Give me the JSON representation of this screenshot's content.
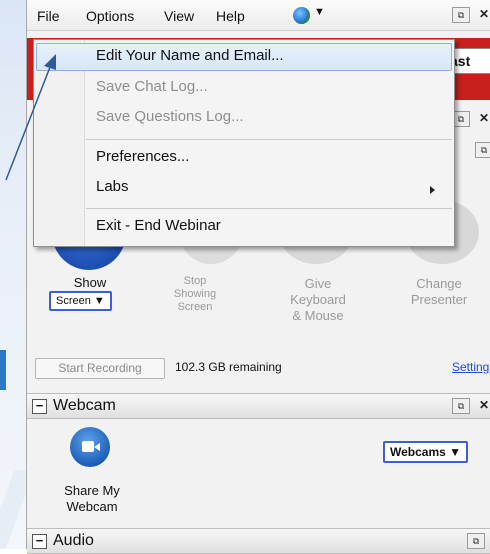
{
  "menubar": {
    "file": "File",
    "options": "Options",
    "view": "View",
    "help": "Help",
    "globe_icon": "globe-icon"
  },
  "options_menu": {
    "items": [
      {
        "label": "Edit Your Name and Email...",
        "enabled": true,
        "highlighted": true
      },
      {
        "label": "Save Chat Log...",
        "enabled": false
      },
      {
        "label": "Save Questions Log...",
        "enabled": false
      },
      {
        "label": "Preferences...",
        "enabled": true
      },
      {
        "label": "Labs",
        "enabled": true,
        "submenu": true
      },
      {
        "label": "Exit - End Webinar",
        "enabled": true
      }
    ]
  },
  "behind": {
    "broadcast_partial": "ast"
  },
  "screen_section": {
    "show": {
      "label": "Show",
      "dropdown": "Screen"
    },
    "stop_showing": {
      "line1": "Stop",
      "line2": "Showing",
      "line3": "Screen"
    },
    "give_control": {
      "line1": "Give",
      "line2": "Keyboard",
      "line3": "& Mouse"
    },
    "change_presenter": {
      "line1": "Change",
      "line2": "Presenter"
    },
    "start_recording": "Start Recording",
    "remaining": "102.3 GB remaining",
    "settings": "Settings"
  },
  "webcam_section": {
    "title": "Webcam",
    "share_label_1": "Share My",
    "share_label_2": "Webcam",
    "webcams_dropdown": "Webcams"
  },
  "audio_section": {
    "title": "Audio"
  },
  "colors": {
    "highlight": "#d6e6f8",
    "red_banner": "#c8201c",
    "link": "#1a4fd0",
    "show_button": "#1d5fb9"
  }
}
